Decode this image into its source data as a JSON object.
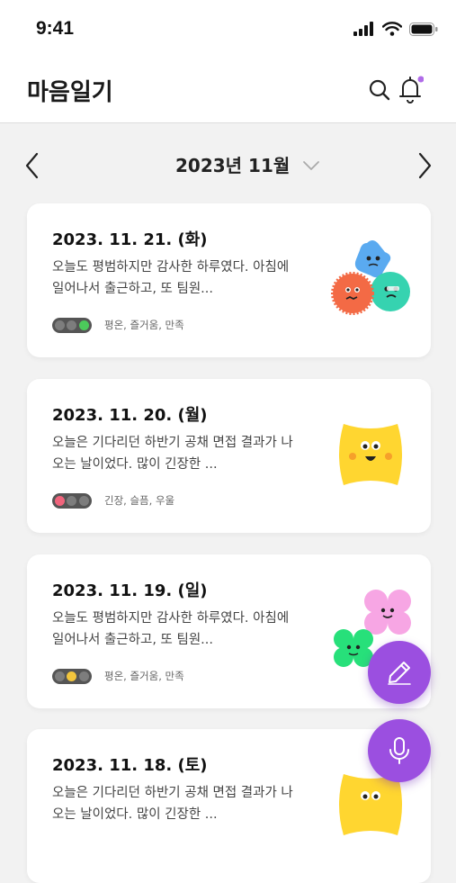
{
  "status_bar": {
    "time": "9:41"
  },
  "header": {
    "title": "마음일기",
    "notification_dot_color": "#b06ce8"
  },
  "month_nav": {
    "label": "2023년 11월"
  },
  "entries": [
    {
      "date": "2023. 11. 21. (화)",
      "line1": "오늘도 평범하지만 감사한 하루였다. 아침에",
      "line2": "일어나서 출근하고, 또 팀원...",
      "tags": "평온, 즐거움, 만족",
      "mood_lights": [
        "off",
        "off",
        "green"
      ]
    },
    {
      "date": "2023. 11. 20. (월)",
      "line1": "오늘은 기다리던 하반기 공채 면접 결과가 나",
      "line2": "오는 날이었다. 많이 긴장한 ...",
      "tags": "긴장, 슬픔, 우울",
      "mood_lights": [
        "red",
        "off",
        "off"
      ]
    },
    {
      "date": "2023. 11. 19. (일)",
      "line1": "오늘도 평범하지만 감사한 하루였다. 아침에",
      "line2": "일어나서 출근하고, 또 팀원...",
      "tags": "평온, 즐거움, 만족",
      "mood_lights": [
        "off",
        "yellow",
        "off"
      ]
    },
    {
      "date": "2023. 11. 18. (토)",
      "line1": "오늘은 기다리던 하반기 공채 면접 결과가 나",
      "line2": "오는 날이었다. 많이 긴장한 ...",
      "tags": "",
      "mood_lights": []
    }
  ],
  "colors": {
    "accent": "#9b4fe0",
    "green": "#4cc95b",
    "red": "#f0647c",
    "yellow": "#f2c53d"
  }
}
